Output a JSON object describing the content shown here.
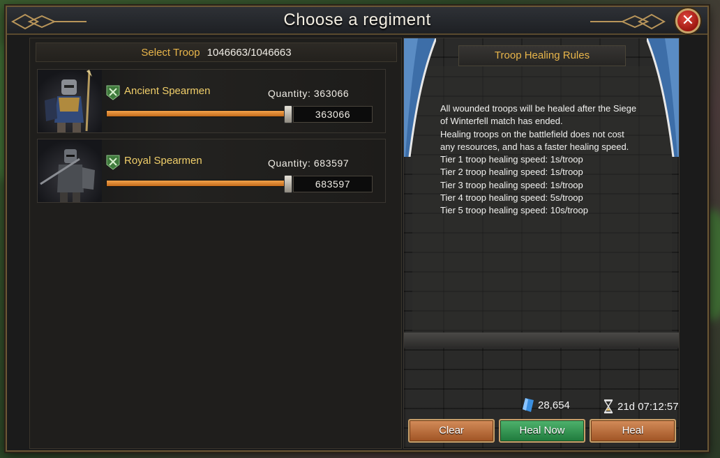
{
  "dialog": {
    "title": "Choose a regiment",
    "close_icon": "close-icon"
  },
  "select": {
    "label": "Select Troop",
    "count": "1046663/1046663"
  },
  "troops": [
    {
      "name": "Ancient Spearmen",
      "quantity_label": "Quantity: 363066",
      "value": "363066",
      "slider_fraction": 1.0,
      "badge_icon": "spearmen-badge-icon"
    },
    {
      "name": "Royal Spearmen",
      "quantity_label": "Quantity: 683597",
      "value": "683597",
      "slider_fraction": 1.0,
      "badge_icon": "spearmen-badge-icon"
    }
  ],
  "rules": {
    "title": "Troop Healing Rules",
    "lines": [
      "All wounded troops will be healed after the Siege",
      "of Winterfell match has ended.",
      "Healing troops on the battlefield does not cost",
      "any resources, and has a faster healing speed.",
      "Tier 1 troop healing speed: 1s/troop",
      "Tier 2 troop healing speed: 1s/troop",
      "Tier 3 troop healing speed: 1s/troop",
      "Tier 4 troop healing speed: 5s/troop",
      "Tier 5 troop healing speed: 10s/troop"
    ]
  },
  "resources": {
    "gems": "28,654",
    "gem_icon": "gem-icon",
    "timer": "21d 07:12:57",
    "timer_icon": "hourglass-icon"
  },
  "buttons": {
    "clear": "Clear",
    "heal_now": "Heal Now",
    "heal": "Heal"
  },
  "colors": {
    "accent_gold": "#e8b54a",
    "name_gold": "#f1cf6a",
    "slider_orange": "#e08a3a",
    "heal_now_green": "#2f9450",
    "button_orange": "#b8693a",
    "close_red": "#c22a20"
  }
}
